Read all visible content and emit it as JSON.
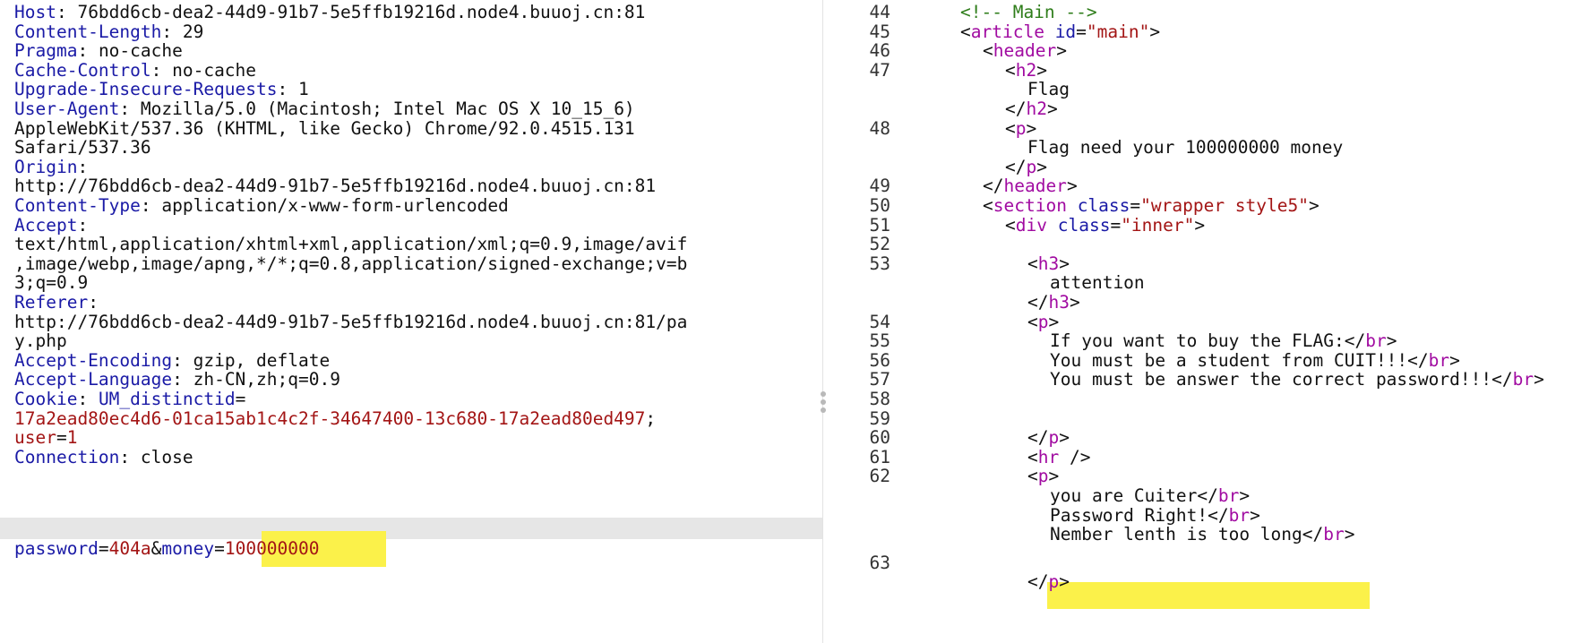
{
  "request": {
    "headers": [
      {
        "key": "Host",
        "sep": ": ",
        "value": "76bdd6cb-dea2-44d9-91b7-5e5ffb19216d.node4.buuoj.cn:81"
      },
      {
        "key": "Content-Length",
        "sep": ": ",
        "value": "29"
      },
      {
        "key": "Pragma",
        "sep": ": ",
        "value": "no-cache"
      },
      {
        "key": "Cache-Control",
        "sep": ": ",
        "value": "no-cache"
      },
      {
        "key": "Upgrade-Insecure-Requests",
        "sep": ": ",
        "value": "1"
      },
      {
        "key": "User-Agent",
        "sep": ": ",
        "value": "Mozilla/5.0 (Macintosh; Intel Mac OS X 10_15_6)"
      },
      {
        "value": "AppleWebKit/537.36 (KHTML, like Gecko) Chrome/92.0.4515.131"
      },
      {
        "value": "Safari/537.36"
      },
      {
        "key": "Origin",
        "sep": ":",
        "value": ""
      },
      {
        "value": "http://76bdd6cb-dea2-44d9-91b7-5e5ffb19216d.node4.buuoj.cn:81"
      },
      {
        "key": "Content-Type",
        "sep": ": ",
        "value": "application/x-www-form-urlencoded"
      },
      {
        "key": "Accept",
        "sep": ":",
        "value": ""
      },
      {
        "value": "text/html,application/xhtml+xml,application/xml;q=0.9,image/avif"
      },
      {
        "value": ",image/webp,image/apng,*/*;q=0.8,application/signed-exchange;v=b"
      },
      {
        "value": "3;q=0.9"
      },
      {
        "key": "Referer",
        "sep": ":",
        "value": ""
      },
      {
        "value": "http://76bdd6cb-dea2-44d9-91b7-5e5ffb19216d.node4.buuoj.cn:81/pa"
      },
      {
        "value": "y.php"
      },
      {
        "key": "Accept-Encoding",
        "sep": ": ",
        "value": "gzip, deflate"
      },
      {
        "key": "Accept-Language",
        "sep": ": ",
        "value": "zh-CN,zh;q=0.9"
      },
      {
        "key": "Cookie",
        "sep": ": ",
        "value": "",
        "cookie_name": "UM_distinctid",
        "cookie_eq": "="
      },
      {
        "value": "17a2ead80ec4d6-01ca15ab1c4c2f-34647400-13c680-17a2ead80ed497",
        "red": true,
        "tail": ";"
      },
      {
        "cookie_name": "user",
        "cookie_eq": "=",
        "red_value": "1"
      },
      {
        "key": "Connection",
        "sep": ": ",
        "value": "close"
      }
    ],
    "body": {
      "password_key": "password",
      "eq1": "=",
      "password_value": "404a",
      "amp": "&",
      "money_key": "money",
      "eq2": "=",
      "money_value": "100000000"
    }
  },
  "response": {
    "line_numbers": [
      "44",
      "45",
      "46",
      "47",
      "48",
      "49",
      "50",
      "51",
      "52",
      "53",
      "54",
      "55",
      "56",
      "57",
      "58",
      "59",
      "60",
      "61",
      "62",
      "63"
    ],
    "lines": [
      {
        "indent": 0,
        "comment": "<!-- Main -->"
      },
      {
        "indent": 0,
        "lt": "<",
        "tag": "article",
        "attr": "id",
        "eq": "=",
        "val": "\"main\"",
        "gt": ">"
      },
      {
        "indent": 1,
        "lt": "<",
        "tag": "header",
        "gt": ">"
      },
      {
        "indent": 2,
        "lt": "<",
        "tag": "h2",
        "gt": ">"
      },
      {
        "indent": 3,
        "text": "Flag"
      },
      {
        "indent": 2,
        "lt": "</",
        "tag": "h2",
        "gt": ">"
      },
      {
        "indent": 2,
        "lt": "<",
        "tag": "p",
        "gt": ">"
      },
      {
        "indent": 3,
        "text": "Flag need your 100000000 money"
      },
      {
        "indent": 2,
        "lt": "</",
        "tag": "p",
        "gt": ">"
      },
      {
        "indent": 1,
        "lt": "</",
        "tag": "header",
        "gt": ">"
      },
      {
        "indent": 1,
        "lt": "<",
        "tag": "section",
        "attr": "class",
        "eq": "=",
        "val": "\"wrapper style5\"",
        "gt": ">"
      },
      {
        "indent": 2,
        "lt": "<",
        "tag": "div",
        "attr": "class",
        "eq": "=",
        "val": "\"inner\"",
        "gt": ">"
      },
      {
        "indent": 0,
        "text": ""
      },
      {
        "indent": 3,
        "lt": "<",
        "tag": "h3",
        "gt": ">"
      },
      {
        "indent": 4,
        "text": "attention"
      },
      {
        "indent": 3,
        "lt": "</",
        "tag": "h3",
        "gt": ">"
      },
      {
        "indent": 3,
        "lt": "<",
        "tag": "p",
        "gt": ">"
      },
      {
        "indent": 4,
        "text": "If you want to buy the FLAG:",
        "lt2": "</",
        "tag2": "br",
        "gt2": ">"
      },
      {
        "indent": 4,
        "text": "You must be a student from CUIT!!!",
        "lt2": "</",
        "tag2": "br",
        "gt2": ">"
      },
      {
        "indent": 4,
        "text": "You must be answer the correct password!!!",
        "lt2": "</",
        "tag2": "br",
        "gt2": ">"
      },
      {
        "indent": 0,
        "text": ""
      },
      {
        "indent": 0,
        "text": ""
      },
      {
        "indent": 3,
        "lt": "</",
        "tag": "p",
        "gt": ">"
      },
      {
        "indent": 3,
        "lt": "<",
        "tag": "hr",
        "gt": " />"
      },
      {
        "indent": 3,
        "lt": "<",
        "tag": "p",
        "gt": ">"
      },
      {
        "indent": 4,
        "text": "you are Cuiter",
        "lt2": "</",
        "tag2": "br",
        "gt2": ">"
      },
      {
        "indent": 4,
        "text": "Password Right!",
        "lt2": "</",
        "tag2": "br",
        "gt2": ">"
      },
      {
        "indent": 4,
        "text": "Nember lenth is too long",
        "highlight": true,
        "lt2": "</",
        "tag2": "br",
        "gt2": ">"
      },
      {
        "indent": 0,
        "text": ""
      },
      {
        "indent": 3,
        "lt": "</",
        "tag": "p",
        "gt": ">"
      }
    ]
  },
  "colors": {
    "header_key": "#1a1aa6",
    "string_value": "#a31515",
    "tag": "#a10ba1",
    "comment": "#2e7d1a",
    "highlight": "#fbf14a",
    "selected_line": "#e6e6e6"
  }
}
